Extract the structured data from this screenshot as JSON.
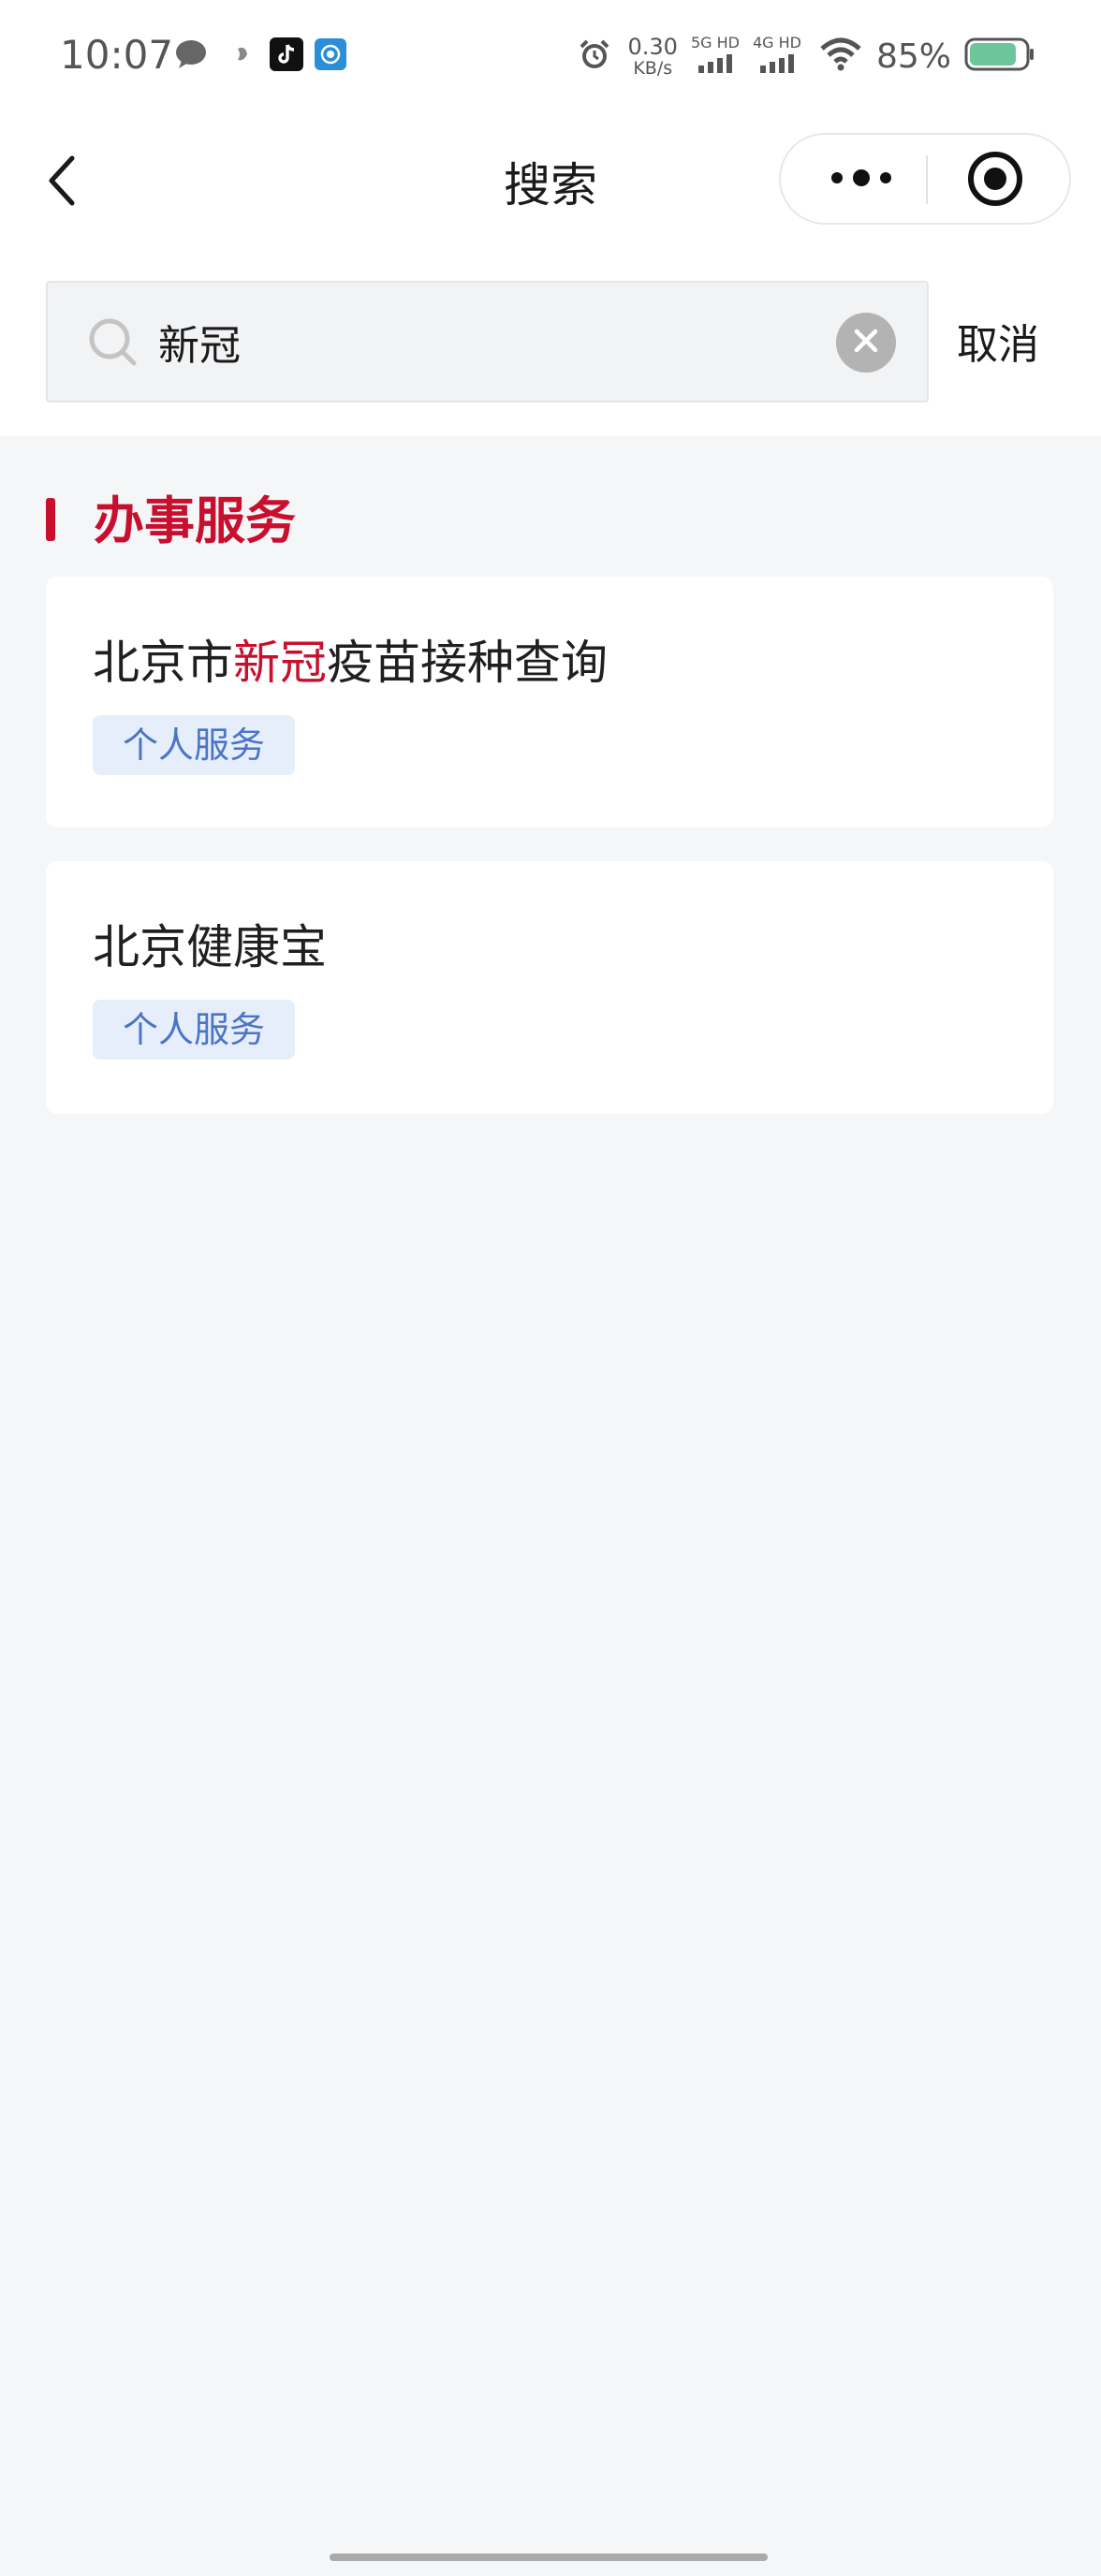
{
  "status_bar": {
    "time": "10:07",
    "net_speed_value": "0.30",
    "net_speed_unit": "KB/s",
    "sim1_label": "5G HD",
    "sim2_label": "4G HD",
    "battery_percent": "85%",
    "battery_level": 0.85,
    "icons": [
      "chat-bubble-icon",
      "bird-icon",
      "tiktok-icon",
      "target-app-icon",
      "alarm-icon",
      "signal-icon",
      "wifi-icon",
      "battery-icon"
    ]
  },
  "nav": {
    "title": "搜索",
    "back_icon": "chevron-left-icon",
    "more_icon": "more-dots-icon",
    "close_icon": "target-close-icon"
  },
  "search": {
    "value": "新冠",
    "placeholder": "",
    "cancel_label": "取消"
  },
  "section": {
    "title": "办事服务"
  },
  "results": [
    {
      "title_parts": [
        "北京市",
        "新冠",
        "疫苗接种查询"
      ],
      "tag": "个人服务"
    },
    {
      "title": "北京健康宝",
      "tag": "个人服务"
    }
  ],
  "colors": {
    "accent_red": "#c8102e",
    "tag_bg": "#e6eefc",
    "tag_text": "#4b74c4",
    "page_bg": "#f5f6f8",
    "battery_green": "#6cc69a"
  }
}
